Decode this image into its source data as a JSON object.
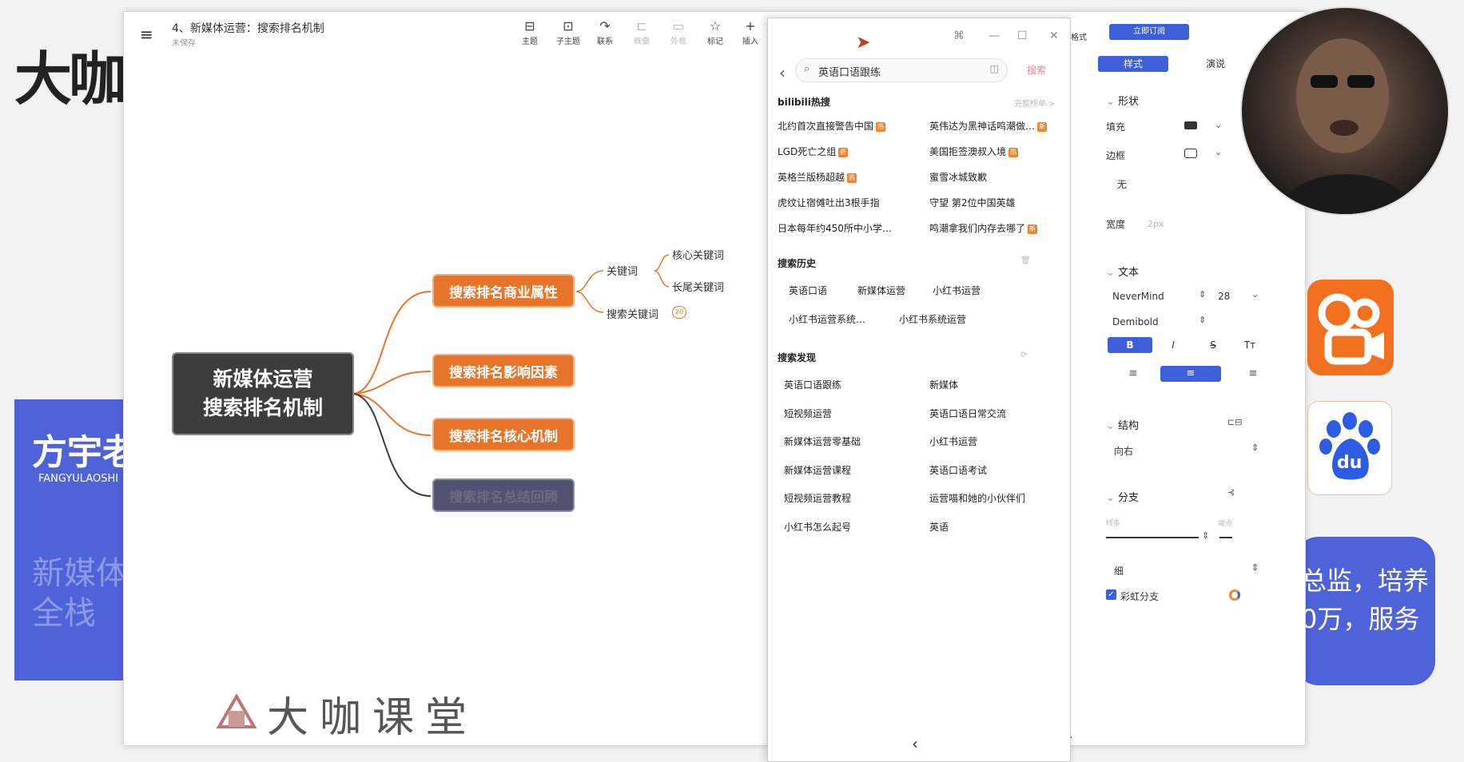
{
  "background": {
    "logo_text": "大咖",
    "promo_left": {
      "name": "方宇老",
      "pinyin": "FANGYULAOSHI",
      "line1": "新媒体",
      "line2": "全栈"
    },
    "promo_right": {
      "line1": "总监，培养",
      "line2": "0万，服务"
    },
    "kuaishou_glyph": "8",
    "baidu_text": "du",
    "watermark": "大咖课堂"
  },
  "window": {
    "menu_icon": "hamburger-icon",
    "title": "4、新媒体运营：搜索排名机制",
    "subtitle": "未保存",
    "toolbar": [
      {
        "label": "主题",
        "icon": "⊟"
      },
      {
        "label": "子主题",
        "icon": "⊡"
      },
      {
        "label": "联系",
        "icon": "↷"
      },
      {
        "label": "概要",
        "icon": "⊏",
        "dim": true
      },
      {
        "label": "外框",
        "icon": "▭",
        "dim": true
      },
      {
        "label": "标记",
        "icon": "☆"
      },
      {
        "label": "插入",
        "icon": "+"
      }
    ]
  },
  "mindmap": {
    "root_line1": "新媒体运营",
    "root_line2": "搜索排名机制",
    "topics": [
      "搜索排名商业属性",
      "搜索排名影响因素",
      "搜索排名核心机制",
      "搜索排名总结回顾"
    ],
    "sub_keyword": "关键词",
    "sub_search": "搜索关键词",
    "sub_core": "核心关键词",
    "sub_long": "长尾关键词",
    "collapsed_count": "20"
  },
  "bilibili": {
    "search_value": "英语口语跟练",
    "search_button": "搜索",
    "hot_title": "bilibili热搜",
    "hot_extra": "完整榜单 >",
    "hot_items": [
      {
        "text": "北约首次直接警告中国",
        "badge": "热"
      },
      {
        "text": "英伟达为黑神话鸣潮做…",
        "badge": "新"
      },
      {
        "text": "LGD死亡之组",
        "badge": "新"
      },
      {
        "text": "美国拒签澳叔入境",
        "badge": "热"
      },
      {
        "text": "英格兰版杨超越",
        "badge": "热"
      },
      {
        "text": "蜜雪冰城致歉",
        "badge": ""
      },
      {
        "text": "虎纹让宿傩吐出3根手指",
        "badge": ""
      },
      {
        "text": "守望 第2位中国英雄",
        "badge": ""
      },
      {
        "text": "日本每年约450所中小学…",
        "badge": ""
      },
      {
        "text": "鸣潮拿我们内存去哪了",
        "badge": "新"
      }
    ],
    "history_title": "搜索历史",
    "history_items": [
      "英语口语",
      "新媒体运营",
      "小红书运营",
      "小红书运营系统…",
      "小红书系统运营"
    ],
    "discover_title": "搜索发现",
    "discover_items": [
      "英语口语跟练",
      "新媒体",
      "短视频运营",
      "英语口语日常交流",
      "新媒体运营零基础",
      "小红书运营",
      "新媒体运营课程",
      "英语口语考试",
      "短视频运营教程",
      "运营喵和她的小伙伴们",
      "小红书怎么起号",
      "英语"
    ]
  },
  "style_panel": {
    "subscribe": "立即订阅",
    "format_label": "格式",
    "tab_style": "样式",
    "tab_present": "演说",
    "shape_section": "形状",
    "fill_label": "填充",
    "border_label": "边框",
    "border_style": "无",
    "width_label": "宽度",
    "width_value": "2px",
    "text_section": "文本",
    "font_family": "NeverMind",
    "font_size": "28",
    "font_weight": "Demibold",
    "bold": "B",
    "italic": "I",
    "strike": "S",
    "text_case": "Tт",
    "structure_section": "结构",
    "structure_value": "向右",
    "branch_section": "分支",
    "line_label": "线条",
    "end_label": "端点",
    "thickness": "细",
    "rainbow_label": "彩虹分支",
    "outline_label": "纲"
  },
  "colors": {
    "accent_blue": "#3d5fd8",
    "topic_orange": "#e8742a",
    "root_dark": "#3d3d3d",
    "bili_pink": "#f08090"
  }
}
